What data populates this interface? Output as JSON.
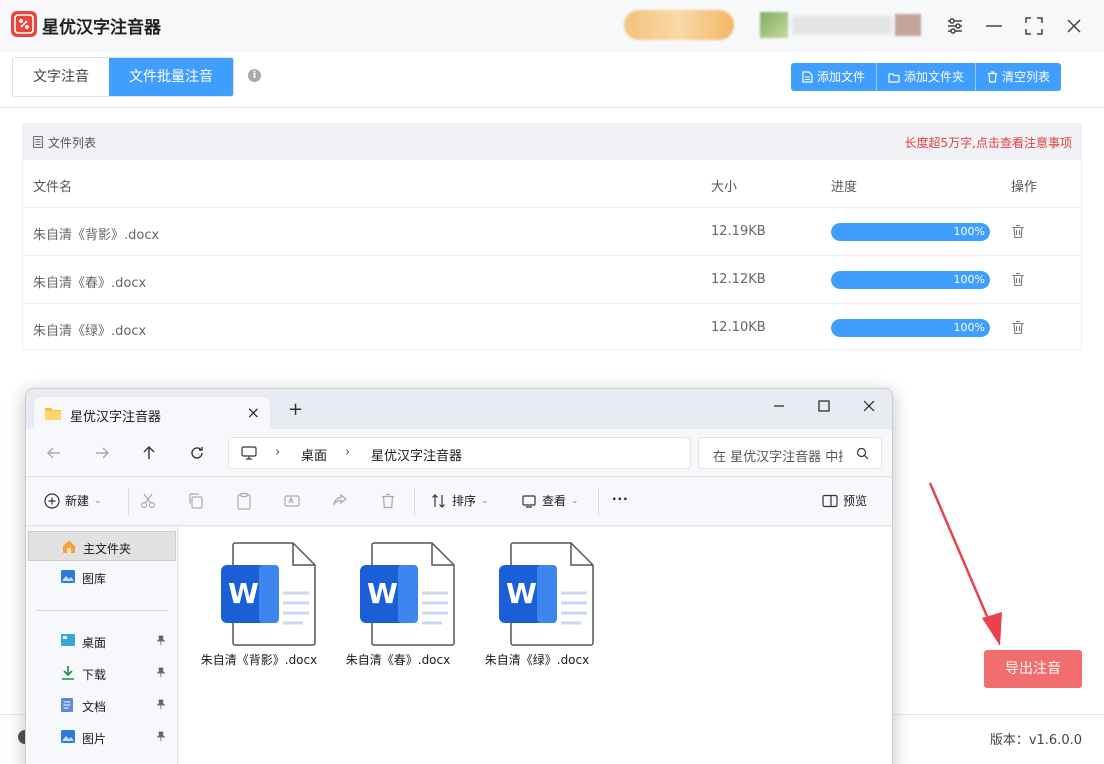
{
  "app": {
    "title": "星优汉字注音器"
  },
  "tabs": [
    {
      "label": "文字注音"
    },
    {
      "label": "文件批量注音"
    }
  ],
  "actions": {
    "add_file": "添加文件",
    "add_folder": "添加文件夹",
    "clear_list": "清空列表"
  },
  "file_list": {
    "title": "文件列表",
    "notice": "长度超5万字,点击查看注意事项",
    "columns": {
      "name": "文件名",
      "size": "大小",
      "progress": "进度",
      "action": "操作"
    },
    "rows": [
      {
        "name": "朱自清《背影》.docx",
        "size": "12.19KB",
        "progress": "100%",
        "progress_value": 1.0
      },
      {
        "name": "朱自清《春》.docx",
        "size": "12.12KB",
        "progress": "100%",
        "progress_value": 1.0
      },
      {
        "name": "朱自清《绿》.docx",
        "size": "12.10KB",
        "progress": "100%",
        "progress_value": 1.0
      }
    ]
  },
  "export_button": "导出注音",
  "version": "版本：v1.6.0.0",
  "explorer": {
    "tab_title": "星优汉字注音器",
    "breadcrumb": [
      "桌面",
      "星优汉字注音器"
    ],
    "search_placeholder": "在 星优汉字注音器 中搜索",
    "toolbar": {
      "new": "新建",
      "sort": "排序",
      "view": "查看",
      "preview": "预览"
    },
    "sidebar": [
      {
        "label": "主文件夹",
        "icon": "home-icon"
      },
      {
        "label": "图库",
        "icon": "gallery-icon"
      },
      {
        "label": "桌面",
        "icon": "desktop-icon"
      },
      {
        "label": "下载",
        "icon": "download-icon"
      },
      {
        "label": "文档",
        "icon": "document-icon"
      },
      {
        "label": "图片",
        "icon": "pictures-icon"
      }
    ],
    "files": [
      {
        "name": "朱自清《背影》.docx",
        "icon": "word-doc-icon"
      },
      {
        "name": "朱自清《春》.docx",
        "icon": "word-doc-icon"
      },
      {
        "name": "朱自清《绿》.docx",
        "icon": "word-doc-icon"
      }
    ]
  },
  "colors": {
    "accent": "#409eff",
    "danger": "#e0403b",
    "export": "#f26d6d",
    "arrow": "#e8434c"
  }
}
